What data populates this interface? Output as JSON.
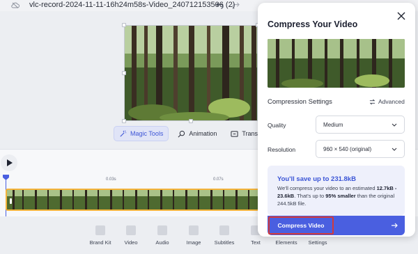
{
  "header": {
    "file_title": "vlc-record-2024-11-11-16h24m58s-Video_240712153506 (2)"
  },
  "editor_tools": [
    {
      "label": "Magic Tools",
      "icon": "magic-tools-icon",
      "active": true
    },
    {
      "label": "Animation",
      "icon": "animation-icon",
      "active": false
    },
    {
      "label": "Transitions",
      "icon": "transitions-icon",
      "active": false
    }
  ],
  "timeline": {
    "ticks": [
      "0.03s",
      "0.07s"
    ]
  },
  "bottom_nav": [
    {
      "label": "Brand Kit",
      "icon": "brand-kit-icon"
    },
    {
      "label": "Video",
      "icon": "video-icon"
    },
    {
      "label": "Audio",
      "icon": "audio-icon"
    },
    {
      "label": "Image",
      "icon": "image-icon"
    },
    {
      "label": "Subtitles",
      "icon": "subtitles-icon"
    },
    {
      "label": "Text",
      "icon": "text-icon"
    },
    {
      "label": "Elements",
      "icon": "elements-icon"
    },
    {
      "label": "Settings",
      "icon": "settings-icon"
    }
  ],
  "modal": {
    "title": "Compress Your Video",
    "settings_heading": "Compression Settings",
    "advanced_label": "Advanced",
    "quality": {
      "label": "Quality",
      "value": "Medium"
    },
    "resolution": {
      "label": "Resolution",
      "value": "960 × 540 (original)"
    },
    "savings": {
      "title": "You'll save up to 231.8kB",
      "line1": "We'll compress your video to an estimated",
      "range": "12.7kB - 23.6kB",
      "line2": ". That's up to ",
      "percent": "95% smaller",
      "line3": "than the original 244.5kB file."
    },
    "compress_button": "Compress Video"
  },
  "colors": {
    "accent": "#4a5fe0",
    "highlight_border": "#d33a3a",
    "track_border": "#f3b33a"
  }
}
